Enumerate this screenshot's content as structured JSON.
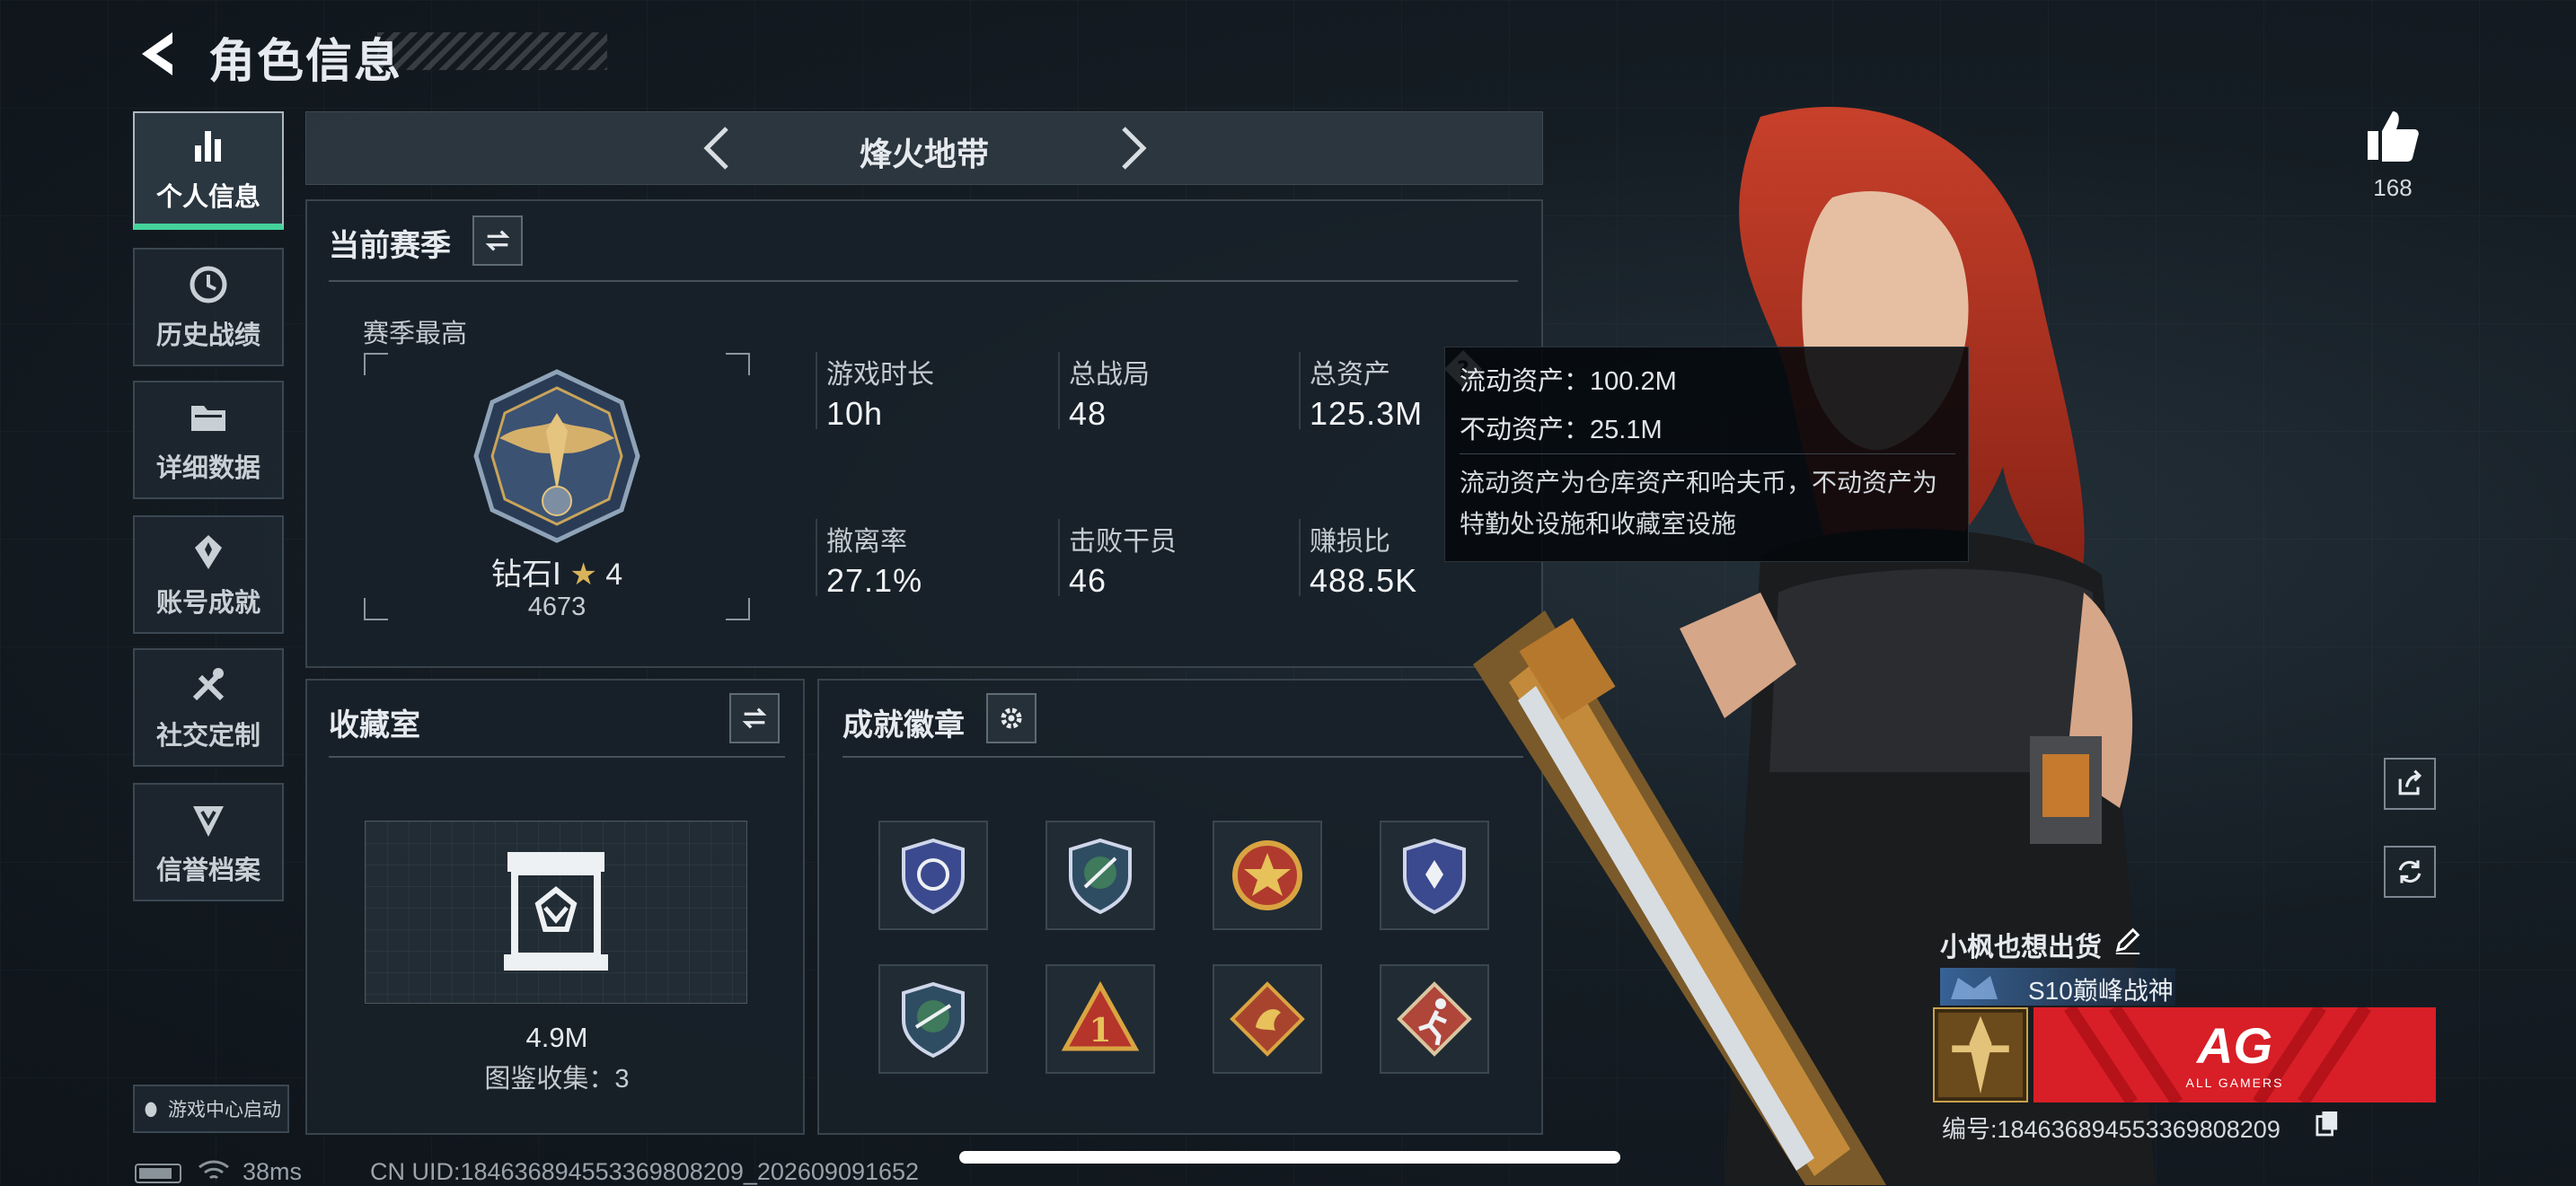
{
  "header": {
    "title": "角色信息"
  },
  "sidebar": {
    "items": [
      {
        "label": "个人信息"
      },
      {
        "label": "历史战绩"
      },
      {
        "label": "详细数据"
      },
      {
        "label": "账号成就"
      },
      {
        "label": "社交定制"
      },
      {
        "label": "信誉档案"
      }
    ],
    "game_center": "游戏中心启动"
  },
  "mode": {
    "name": "烽火地带"
  },
  "season": {
    "title": "当前赛季",
    "highest_label": "赛季最高",
    "rank_name": "钻石Ⅰ",
    "rank_stars": "4",
    "rank_points": "4673",
    "stats": [
      {
        "label": "游戏时长",
        "value": "10h"
      },
      {
        "label": "总战局",
        "value": "48"
      },
      {
        "label": "总资产",
        "value": "125.3M"
      },
      {
        "label": "撤离率",
        "value": "27.1%"
      },
      {
        "label": "击败干员",
        "value": "46"
      },
      {
        "label": "赚损比",
        "value": "488.5K"
      }
    ]
  },
  "tooltip": {
    "liquid": "流动资产：100.2M",
    "fixed": "不动资产：25.1M",
    "desc": "流动资产为仓库资产和哈夫币，不动资产为特勤处设施和收藏室设施"
  },
  "collection": {
    "title": "收藏室",
    "value": "4.9M",
    "count": "图鉴收集：3"
  },
  "achievements": {
    "title": "成就徽章",
    "badges": [
      {
        "icon": "shield-blue-badge-icon",
        "color": "#3b4a8f"
      },
      {
        "icon": "shield-wings-badge-icon",
        "color": "#2f5f4f"
      },
      {
        "icon": "red-star-badge-icon",
        "color": "#b03a2e"
      },
      {
        "icon": "shield-star-badge-icon",
        "color": "#3b4a8f"
      },
      {
        "icon": "shield-rifle-badge-icon",
        "color": "#2f5f4f"
      },
      {
        "icon": "number-one-badge-icon",
        "color": "#b5352b"
      },
      {
        "icon": "dragon-badge-icon",
        "color": "#a8442e"
      },
      {
        "icon": "runner-badge-icon",
        "color": "#b0453a"
      }
    ]
  },
  "player": {
    "likes": "168",
    "name": "小枫也想出货",
    "title": "S10巅峰战神",
    "banner_text": "AG",
    "banner_sub": "ALL GAMERS",
    "uid": "编号:184636894553369808209"
  },
  "status": {
    "ping": "38ms",
    "cn_uid": "CN UID:184636894553369808209_202609091652"
  },
  "colors": {
    "accent": "#44d29b",
    "banner": "#d81e26"
  }
}
